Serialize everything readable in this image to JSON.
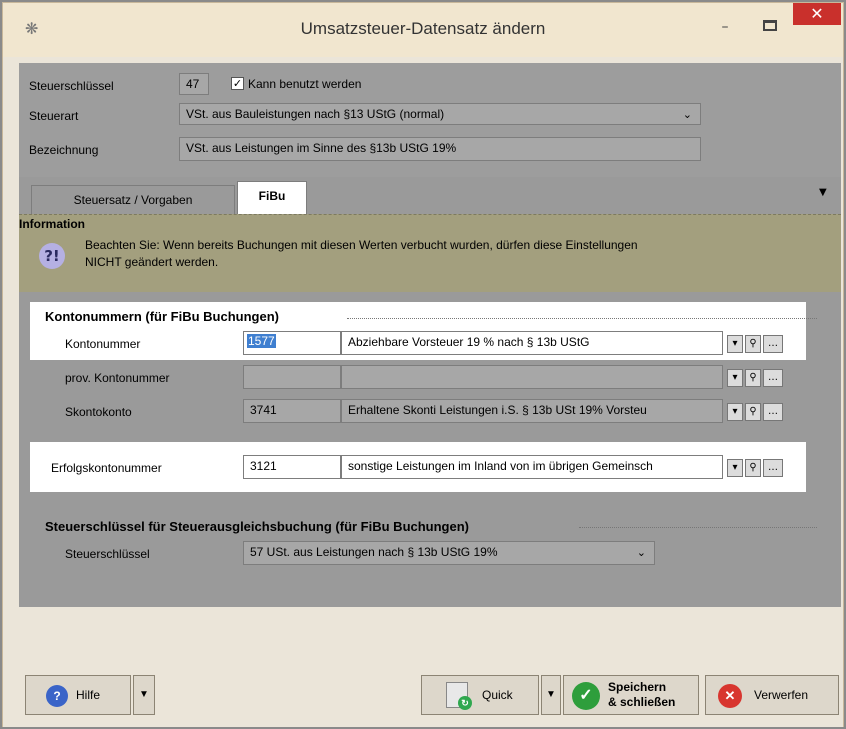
{
  "window": {
    "title": "Umsatzsteuer-Datensatz ändern",
    "close_glyph": "✕",
    "min_glyph": "–"
  },
  "header": {
    "steuerschluessel_label": "Steuerschlüssel",
    "steuerschluessel_value": "47",
    "kann_benutzt_label": "Kann benutzt werden",
    "kann_benutzt_checked": true,
    "steuerart_label": "Steuerart",
    "steuerart_value": "VSt. aus Bauleistungen nach §13 UStG (normal)",
    "bezeichnung_label": "Bezeichnung",
    "bezeichnung_value": "VSt. aus Leistungen im Sinne des §13b UStG 19%"
  },
  "tabs": [
    {
      "label": "Steuersatz / Vorgaben",
      "active": false
    },
    {
      "label": "FiBu",
      "active": true
    }
  ],
  "info": {
    "title": "Information",
    "icon": "question-exclamation-icon",
    "line1": "Beachten Sie: Wenn bereits Buchungen mit diesen Werten verbucht wurden, dürfen diese Einstellungen",
    "line2": "NICHT geändert werden."
  },
  "konten": {
    "section_title": "Kontonummern (für FiBu Buchungen)",
    "rows": [
      {
        "label": "Kontonummer",
        "number": "1577",
        "description": "Abziehbare Vorsteuer 19 % nach § 13b UStG"
      },
      {
        "label": "prov. Kontonummer",
        "number": "",
        "description": ""
      },
      {
        "label": "Skontokonto",
        "number": "3741",
        "description": "Erhaltene Skonti Leistungen i.S. § 13b USt 19% Vorsteu"
      },
      {
        "label": "Erfolgskontonummer",
        "number": "3121",
        "description": "sonstige Leistungen im Inland von im übrigen Gemeinsch"
      }
    ]
  },
  "ausgleich": {
    "section_title": "Steuerschlüssel für Steuerausgleichsbuchung (für FiBu Buchungen)",
    "label": "Steuerschlüssel",
    "value": "57 USt. aus Leistungen nach § 13b UStG 19%"
  },
  "footer": {
    "hilfe_label": "Hilfe",
    "quick_label": "Quick",
    "save_label_1": "Speichern",
    "save_label_2": "& schließen",
    "discard_label": "Verwerfen"
  }
}
